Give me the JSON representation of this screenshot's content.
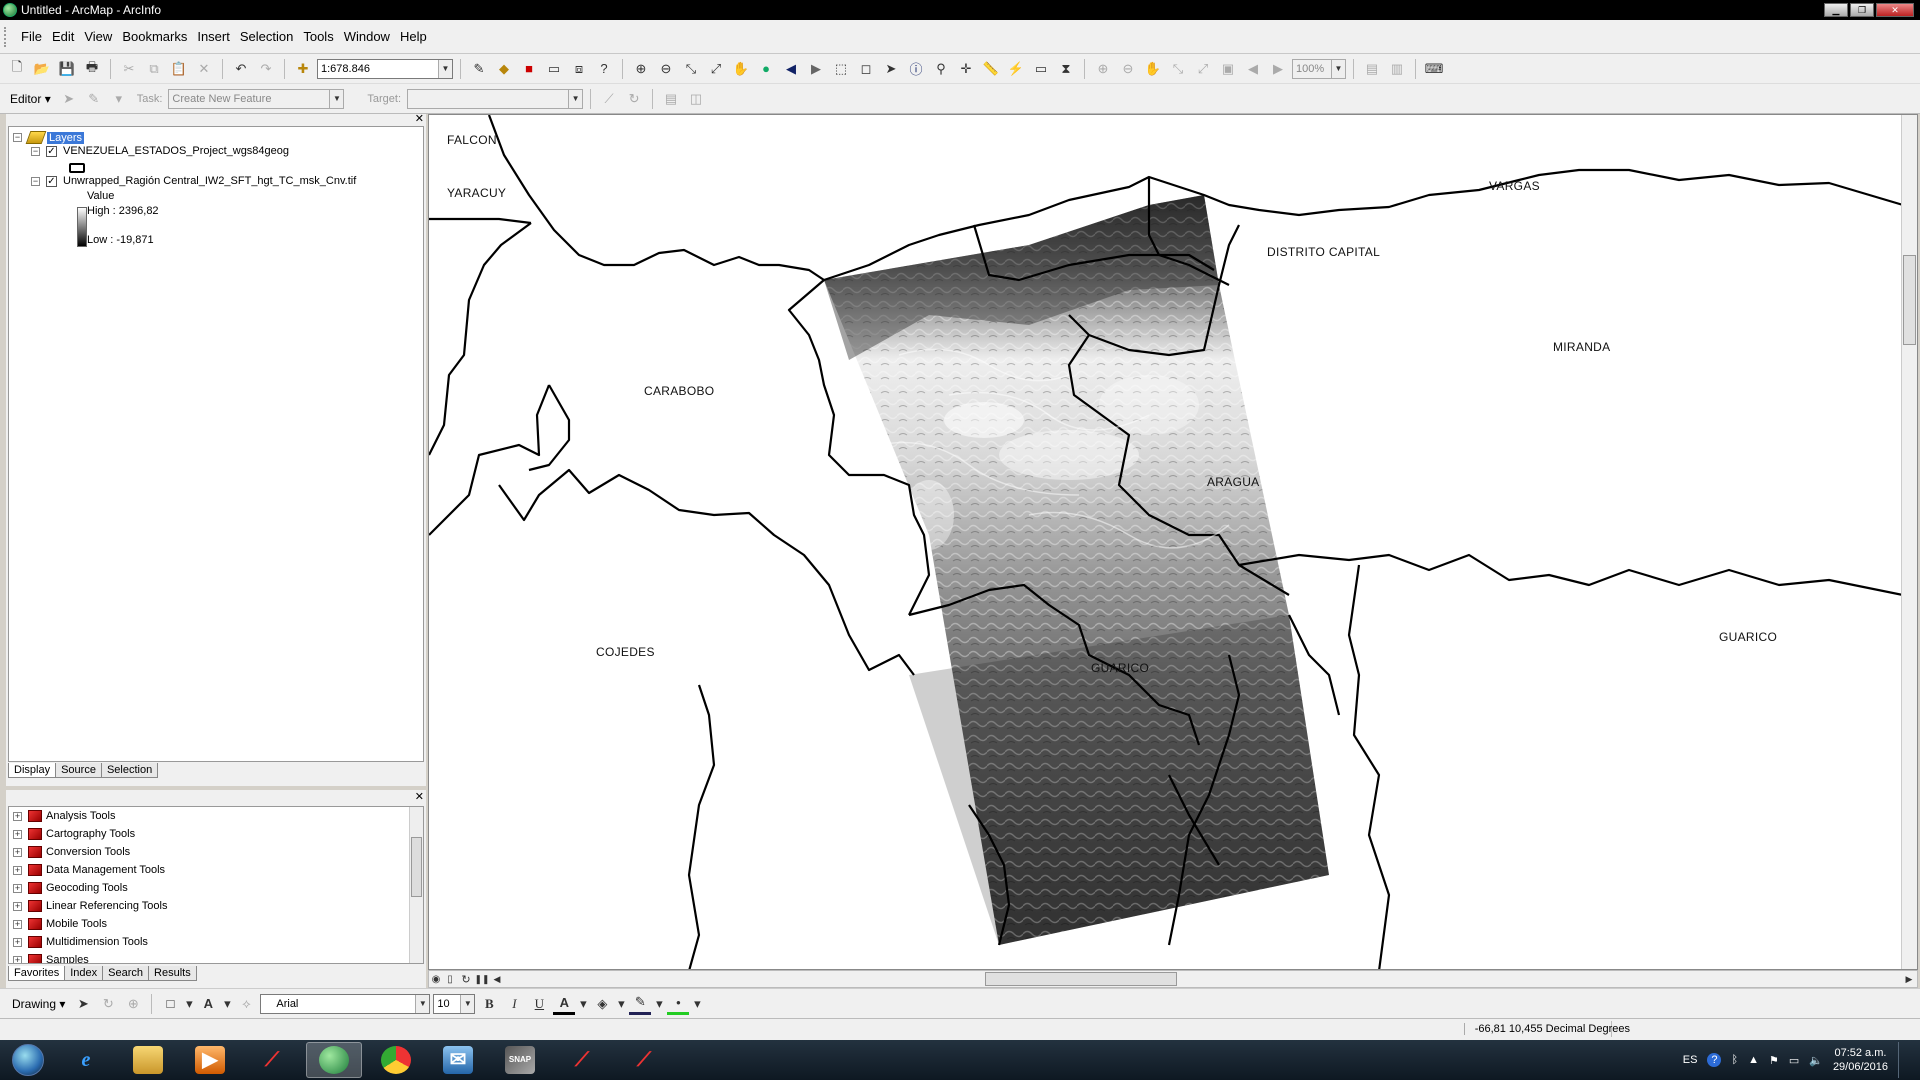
{
  "window": {
    "title": "Untitled - ArcMap - ArcInfo"
  },
  "menu": [
    "File",
    "Edit",
    "View",
    "Bookmarks",
    "Insert",
    "Selection",
    "Tools",
    "Window",
    "Help"
  ],
  "toolbar1": {
    "scale": "1:678.846",
    "zoom_pct": "100%"
  },
  "toolbar2": {
    "editor_label": "Editor",
    "task_label": "Task:",
    "task_value": "Create New Feature",
    "target_label": "Target:",
    "target_value": ""
  },
  "toc": {
    "root_label": "Layers",
    "layer1_name": "VENEZUELA_ESTADOS_Project_wgs84geog",
    "layer2_name": "Unwrapped_Ragión Central_IW2_SFT_hgt_TC_msk_Cnv.tif",
    "value_label": "Value",
    "high_label": "High : 2396,82",
    "low_label": "Low : -19,871",
    "tabs": [
      "Display",
      "Source",
      "Selection"
    ]
  },
  "toolbox": {
    "items": [
      "Analysis Tools",
      "Cartography Tools",
      "Conversion Tools",
      "Data Management Tools",
      "Geocoding Tools",
      "Linear Referencing Tools",
      "Mobile Tools",
      "Multidimension Tools",
      "Samples"
    ],
    "tabs": [
      "Favorites",
      "Index",
      "Search",
      "Results"
    ]
  },
  "map": {
    "labels": {
      "falcon": "FALCON",
      "yaracuy": "YARACUY",
      "vargas": "VARGAS",
      "distrito": "DISTRITO CAPITAL",
      "miranda": "MIRANDA",
      "carabobo": "CARABOBO",
      "aragua": "ARAGUA",
      "cojedes": "COJEDES",
      "guarico1": "GUARICO",
      "guarico2": "GUARICO"
    }
  },
  "drawing": {
    "label": "Drawing",
    "font": "Arial",
    "size": "10",
    "bold": "B",
    "italic": "I",
    "underline": "U"
  },
  "status": {
    "coords": "-66,81  10,455 Decimal Degrees"
  },
  "taskbar": {
    "lang": "ES",
    "time": "07:52 a.m.",
    "date": "29/06/2016"
  },
  "colors": {
    "titlebar": "#000000",
    "selection": "#3b78d8",
    "dem_high": "#ffffff",
    "dem_low": "#000000"
  }
}
